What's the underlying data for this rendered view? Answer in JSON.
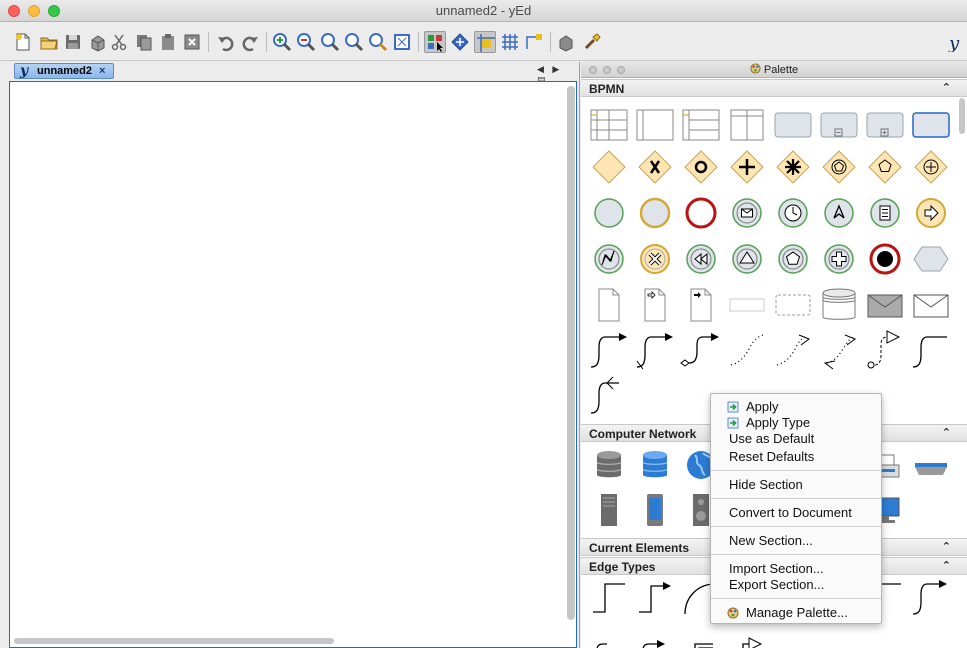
{
  "window": {
    "title": "unnamed2 - yEd"
  },
  "editor": {
    "tab_label": "unnamed2",
    "tab_close": "×",
    "tab_nav": "◀ ▶ ▤"
  },
  "palette": {
    "title": "Palette",
    "sections": [
      {
        "name": "BPMN",
        "chevron": "⌃"
      },
      {
        "name": "Computer Network",
        "chevron": "⌃"
      },
      {
        "name": "Current Elements",
        "chevron": "⌃"
      },
      {
        "name": "Edge Types",
        "chevron": "⌃"
      }
    ]
  },
  "context_menu": {
    "items": [
      {
        "label": "Apply",
        "icon": "apply-icon"
      },
      {
        "label": "Apply Type",
        "icon": "apply-icon"
      },
      {
        "label": "Use as Default"
      },
      {
        "label": "Reset Defaults"
      },
      {
        "label": "Hide Section"
      },
      {
        "label": "Convert to Document"
      },
      {
        "label": "New Section..."
      },
      {
        "label": "Import Section..."
      },
      {
        "label": "Export Section..."
      },
      {
        "label": "Manage Palette...",
        "icon": "palette-icon"
      }
    ]
  },
  "colors": {
    "accent_blue": "#2466c9",
    "bpmn_fill": "#fde6b4",
    "bpmn_stroke": "#c8a35a",
    "start_event": "#54a054",
    "end_event": "#b81414"
  }
}
